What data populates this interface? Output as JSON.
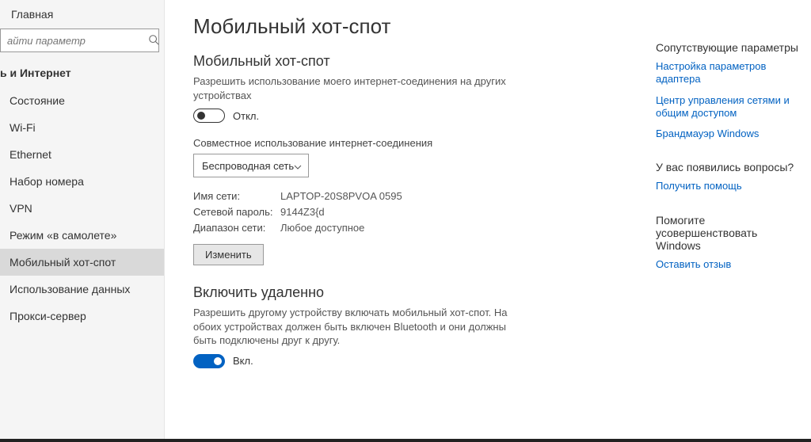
{
  "sidebar": {
    "home": "Главная",
    "search_placeholder": "айти параметр",
    "category": "ь и Интернет",
    "items": [
      {
        "label": "Состояние"
      },
      {
        "label": "Wi-Fi"
      },
      {
        "label": "Ethernet"
      },
      {
        "label": "Набор номера"
      },
      {
        "label": "VPN"
      },
      {
        "label": "Режим «в самолете»"
      },
      {
        "label": "Мобильный хот-спот"
      },
      {
        "label": "Использование данных"
      },
      {
        "label": "Прокси-сервер"
      }
    ],
    "selected_index": 6
  },
  "main": {
    "title": "Мобильный хот-спот",
    "hotspot": {
      "heading": "Мобильный хот-спот",
      "desc": "Разрешить использование моего интернет-соединения на других устройствах",
      "state_label": "Откл."
    },
    "sharing": {
      "label": "Совместное использование интернет-соединения",
      "selected": "Беспроводная сеть"
    },
    "network": {
      "name_key": "Имя сети:",
      "name_val": "LAPTOP-20S8PVOA 0595",
      "pass_key": "Сетевой пароль:",
      "pass_val": "9144Z3{d",
      "band_key": "Диапазон сети:",
      "band_val": "Любое доступное",
      "edit_btn": "Изменить"
    },
    "remote": {
      "heading": "Включить удаленно",
      "desc": "Разрешить другому устройству включать мобильный хот-спот. На обоих устройствах должен быть включен Bluetooth и они должны быть подключены друг к другу.",
      "state_label": "Вкл."
    }
  },
  "rail": {
    "related_title": "Сопутствующие параметры",
    "related_links": [
      "Настройка параметров адаптера",
      "Центр управления сетями и общим доступом",
      "Брандмауэр Windows"
    ],
    "help_title": "У вас появились вопросы?",
    "help_link": "Получить помощь",
    "feedback_title": "Помогите усовершенствовать Windows",
    "feedback_link": "Оставить отзыв"
  }
}
